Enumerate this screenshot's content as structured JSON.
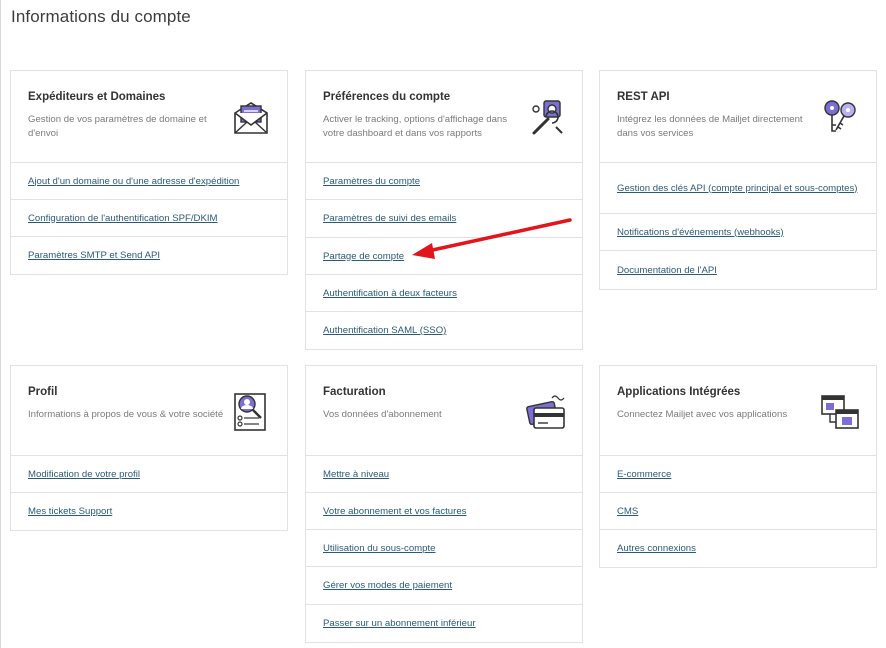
{
  "page": {
    "title": "Informations du compte"
  },
  "cards": {
    "senders": {
      "title": "Expéditeurs et Domaines",
      "description": "Gestion de vos paramètres de domaine et d'envoi",
      "icon": "envelope-icon",
      "links": [
        "Ajout d'un domaine ou d'une adresse d'expédition",
        "Configuration de l'authentification SPF/DKIM",
        "Paramètres SMTP et Send API"
      ]
    },
    "preferences": {
      "title": "Préférences du compte",
      "description": "Activer le tracking, options d'affichage dans votre dashboard et dans vos rapports",
      "icon": "settings-tools-icon",
      "links": [
        "Paramètres du compte",
        "Paramètres de suivi des emails",
        "Partage de compte",
        "Authentification à deux facteurs",
        "Authentification SAML (SSO)"
      ]
    },
    "rest_api": {
      "title": "REST API",
      "description": "Intégrez les données de Mailjet directement dans vos services",
      "icon": "keys-icon",
      "links": [
        "Gestion des clés API (compte principal et sous-comptes)",
        "Notifications d'événements (webhooks)",
        "Documentation de l'API"
      ]
    },
    "profile": {
      "title": "Profil",
      "description": "Informations à propos de vous & votre société",
      "icon": "profile-id-icon",
      "links": [
        "Modification de votre profil",
        "Mes tickets Support"
      ]
    },
    "billing": {
      "title": "Facturation",
      "description": "Vos données d'abonnement",
      "icon": "credit-card-icon",
      "links": [
        "Mettre à niveau",
        "Votre abonnement et vos factures",
        "Utilisation du sous-compte",
        "Gérer vos modes de paiement",
        "Passer sur un abonnement inférieur"
      ]
    },
    "integrations": {
      "title": "Applications Intégrées",
      "description": "Connectez Mailjet avec vos applications",
      "icon": "connected-apps-icon",
      "links": [
        "E-commerce",
        "CMS",
        "Autres connexions"
      ]
    }
  },
  "annotation": {
    "icon": "red-arrow-icon",
    "color": "#e3141b"
  },
  "colors": {
    "link": "#2a5a7a",
    "accent_purple": "#7b6fd6",
    "border": "#e2e2e2"
  }
}
